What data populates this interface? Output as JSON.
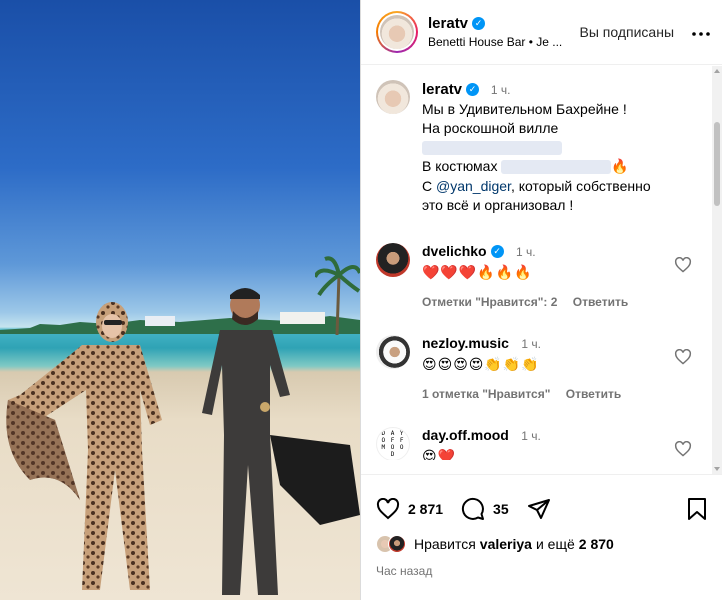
{
  "header": {
    "username": "leratv",
    "verified_mark": "✓",
    "location": "Benetti House Bar • Je ...",
    "follow_status": "Вы подписаны",
    "more_icon": "more-horizontal-icon"
  },
  "caption": {
    "username": "leratv",
    "time": "1 ч.",
    "line1": "Мы в Удивительном Бахрейне !",
    "line2": "На роскошной вилле",
    "line3a": "В костюмах",
    "line3b": "🔥",
    "line4a": "С",
    "line4_mention": "@yan_diger",
    "line4b": ", который собственно",
    "line5": "это всё и организовал !"
  },
  "comments": [
    {
      "username": "dvelichko",
      "verified": true,
      "time": "1 ч.",
      "text": "❤️❤️❤️🔥🔥🔥",
      "likes": "Отметки \"Нравится\": 2",
      "reply": "Ответить"
    },
    {
      "username": "nezloy.music",
      "verified": false,
      "time": "1 ч.",
      "text": "😍😍😍😍👏👏👏",
      "likes": "1 отметка \"Нравится\"",
      "reply": "Ответить"
    },
    {
      "username": "day.off.mood",
      "verified": false,
      "time": "1 ч.",
      "text": "😍❤️",
      "avatar_text": "D A Y O F F M O O D"
    }
  ],
  "actions": {
    "likes_count": "2 871",
    "comments_count": "35",
    "liked_by_prefix": "Нравится",
    "liked_by_user": "valeriya",
    "liked_by_and": "и ещё",
    "liked_by_rest": "2 870",
    "posted_ago": "Час назад"
  },
  "colors": {
    "accent_blue": "#0095f6",
    "mention_blue": "#00376b",
    "muted": "#737373"
  }
}
